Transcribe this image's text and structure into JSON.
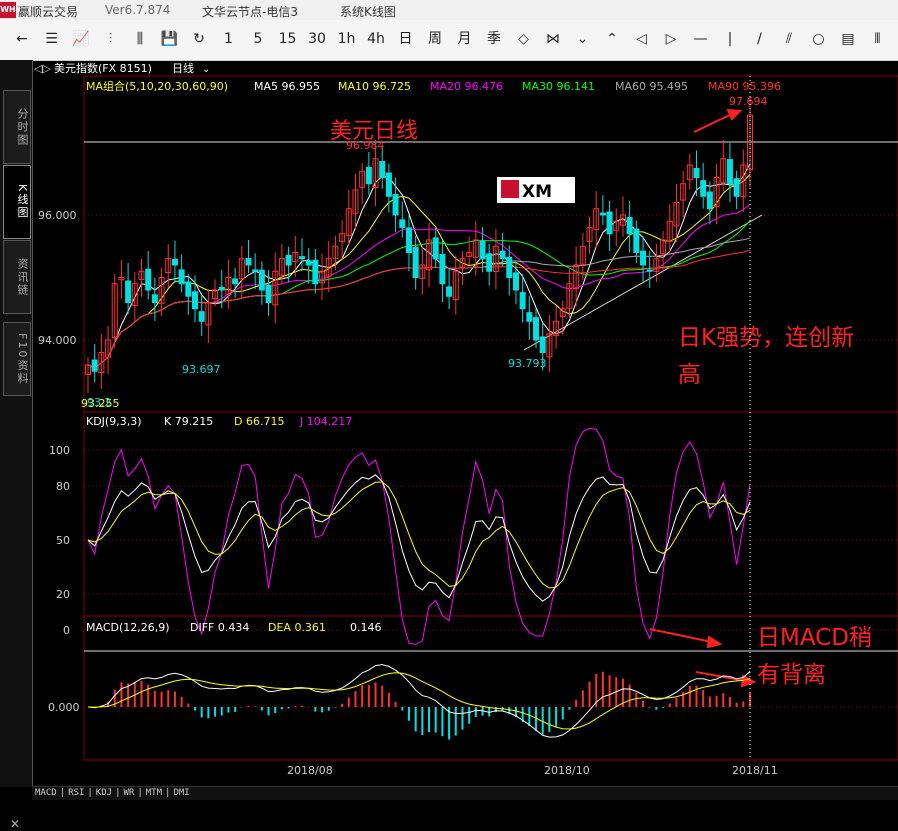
{
  "titlebar": {
    "app": "赢顺云交易",
    "version": "Ver6.7.874",
    "node": "文华云节点-电信3",
    "view": "系统K线图",
    "logo": "WH"
  },
  "toolbar": [
    "←",
    "☰",
    "📈",
    "⫶",
    "⫼",
    "💾",
    "↻",
    "1",
    "5",
    "15",
    "30",
    "1h",
    "4h",
    "日",
    "周",
    "月",
    "季",
    "◇",
    "⋈",
    "⌄",
    "⌃",
    "◁",
    "▷",
    "—",
    "|",
    "/",
    "⫽",
    "○",
    "▤",
    "⦀"
  ],
  "sidebar": {
    "tabs": [
      "分时图",
      "K线图",
      "资讯链",
      "F10资料"
    ],
    "active": 1,
    "close": "✕"
  },
  "header": {
    "nav_icon": "◁▷",
    "symbol": "美元指数(FX 8151)",
    "period": "日线"
  },
  "ma_legend": {
    "group": "MA组合(5,10,20,30,60,90)",
    "ma5": "MA5 96.955",
    "ma10": "MA10 96.725",
    "ma20": "MA20 96.476",
    "ma30": "MA30 96.141",
    "ma60": "MA60 95.495",
    "ma90": "MA90 95.396"
  },
  "kdj_legend": {
    "name": "KDJ(9,3,3)",
    "k": "K 79.215",
    "d": "D 66.715",
    "j": "J 104.217"
  },
  "macd_legend": {
    "name": "MACD(12,26,9)",
    "diff": "DIFF 0.434",
    "dea": "DEA 0.361",
    "macd": "0.146"
  },
  "annotations": {
    "title": "美元日线",
    "k_note_1": "日K强势，连创新",
    "k_note_2": "高",
    "macd_note_1": "日MACD稍",
    "macd_note_2": "有背离"
  },
  "price_labels": {
    "high_recent": "97.694",
    "high_prev": "96.984",
    "low_a": "93.697",
    "low_b": "93.793",
    "low_first": "93.255",
    "low_first_b": "93.2"
  },
  "xm_logo": "XM",
  "bottom_tabs": [
    "MACD",
    "RSI",
    "KDJ",
    "WR",
    "MTM",
    "DMI"
  ],
  "colors": {
    "up": "#ff3030",
    "down": "#00e0e0",
    "ma5": "#ffffff",
    "ma10": "#ffff00",
    "ma20": "#ff00ff",
    "ma30": "#00ff00",
    "ma60": "#aaaaaa",
    "ma90": "#ff3030",
    "annotation": "#ff2020"
  },
  "chart_data": {
    "type": "candlestick",
    "symbol": "美元指数(FX 8151)",
    "period": "日线",
    "x_ticks": [
      "2018/08",
      "2018/10",
      "2018/11"
    ],
    "y_ticks": [
      "96.000",
      "94.000"
    ],
    "kdj_ticks": [
      "100",
      "80",
      "50",
      "20",
      "0"
    ],
    "macd_ticks": [
      "0.000"
    ],
    "close": [
      93.6,
      93.5,
      93.8,
      94.0,
      94.9,
      95.0,
      94.6,
      94.9,
      95.1,
      94.8,
      94.6,
      95.0,
      95.3,
      95.2,
      94.9,
      94.7,
      94.5,
      94.3,
      94.6,
      94.8,
      94.8,
      95.0,
      94.9,
      95.3,
      95.2,
      95.1,
      94.8,
      94.6,
      95.1,
      95.3,
      95.2,
      95.4,
      95.3,
      95.2,
      94.9,
      95.1,
      95.3,
      95.5,
      95.7,
      96.1,
      96.4,
      96.7,
      96.5,
      96.9,
      96.6,
      96.3,
      96.0,
      95.8,
      95.4,
      95.0,
      95.2,
      95.6,
      95.3,
      94.9,
      94.7,
      95.1,
      95.3,
      95.4,
      95.6,
      95.3,
      95.1,
      95.5,
      95.3,
      95.0,
      94.8,
      94.5,
      94.3,
      94.0,
      93.8,
      94.1,
      94.3,
      94.5,
      94.9,
      95.2,
      95.5,
      95.8,
      96.1,
      96.0,
      95.7,
      95.9,
      96.0,
      95.7,
      95.4,
      95.2,
      95.1,
      95.3,
      95.6,
      95.9,
      96.2,
      96.5,
      96.8,
      96.6,
      96.3,
      96.1,
      96.6,
      96.9,
      96.5,
      96.3,
      96.8,
      97.6
    ],
    "ma_values": {
      "MA5": 96.955,
      "MA10": 96.725,
      "MA20": 96.476,
      "MA30": 96.141,
      "MA60": 95.495,
      "MA90": 95.396
    },
    "kdj_values": {
      "K": 79.215,
      "D": 66.715,
      "J": 104.217
    },
    "macd_values": {
      "DIFF": 0.434,
      "DEA": 0.361,
      "MACD": 0.146
    }
  }
}
